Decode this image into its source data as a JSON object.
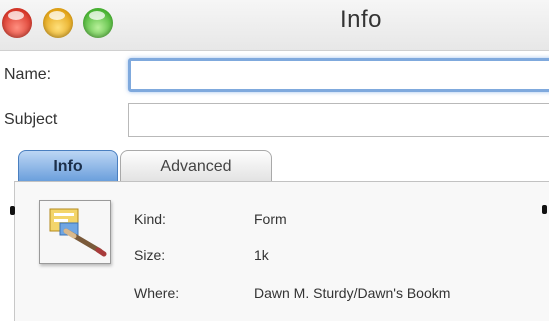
{
  "window": {
    "title": "Info"
  },
  "fields": {
    "name_label": "Name:",
    "name_value": "",
    "subject_label": "Subject",
    "subject_value": ""
  },
  "tabs": [
    {
      "label": "Info",
      "selected": true
    },
    {
      "label": "Advanced",
      "selected": false
    }
  ],
  "info": {
    "icon": "form-document-icon",
    "kind_label": "Kind:",
    "kind_value": "Form",
    "size_label": "Size:",
    "size_value": "1k",
    "where_label": "Where:",
    "where_value": "Dawn M. Sturdy/Dawn's Bookm"
  },
  "colors": {
    "close": "#e0443a",
    "minimize": "#f0b429",
    "zoom": "#5cc23f",
    "focus_ring": "#7fa9dd",
    "selected_tab": "#6b9fdc"
  }
}
